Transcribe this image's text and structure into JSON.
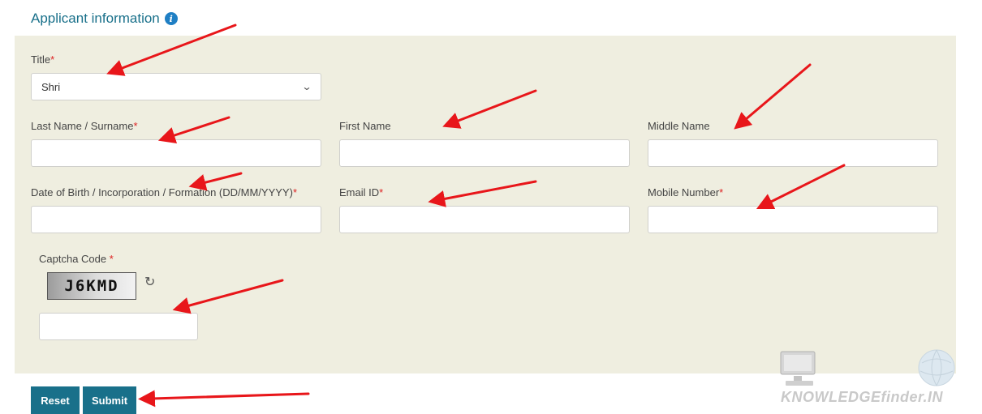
{
  "section": {
    "title": "Applicant information",
    "info_icon": "info-icon"
  },
  "form": {
    "title": {
      "label": "Title",
      "value": "Shri"
    },
    "last_name": {
      "label": "Last Name / Surname",
      "value": ""
    },
    "first_name": {
      "label": "First Name",
      "value": ""
    },
    "middle_name": {
      "label": "Middle Name",
      "value": ""
    },
    "dob": {
      "label": "Date of Birth / Incorporation / Formation (DD/MM/YYYY)",
      "value": ""
    },
    "email": {
      "label": "Email ID",
      "value": ""
    },
    "mobile": {
      "label": "Mobile Number",
      "value": ""
    },
    "captcha": {
      "label": "Captcha Code ",
      "code": "J6KMD",
      "value": ""
    },
    "required_mark": "*"
  },
  "buttons": {
    "reset": "Reset",
    "submit": "Submit"
  },
  "watermark": {
    "text": "KNOWLEDGEfinder.IN"
  },
  "colors": {
    "accent": "#19708a",
    "panel": "#efeee0",
    "arrow": "#e8161a",
    "required": "#dd2222"
  }
}
